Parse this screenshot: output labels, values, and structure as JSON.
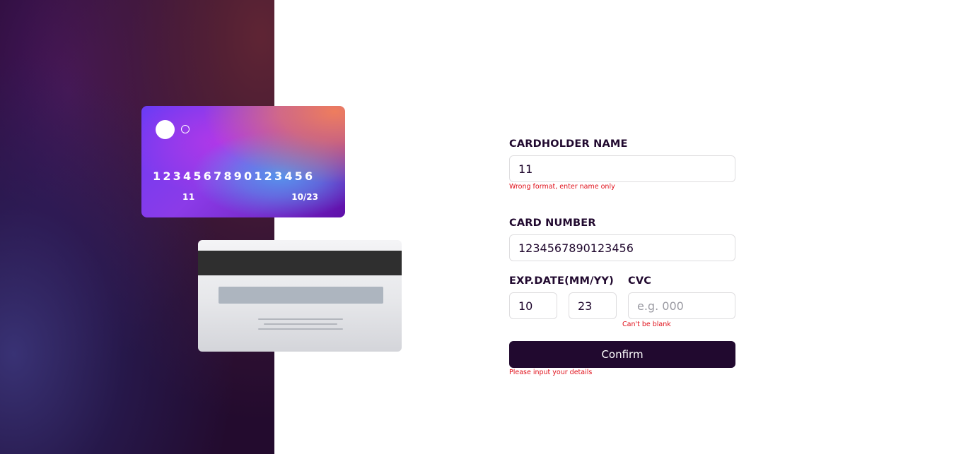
{
  "card_preview": {
    "front": {
      "number": "1234567890123456",
      "name": "11",
      "expiry": "10/23"
    }
  },
  "form": {
    "cardholder": {
      "label": "CARDHOLDER NAME",
      "value": "11",
      "error": "Wrong format, enter name only"
    },
    "card_number": {
      "label": "CARD NUMBER",
      "value": "1234567890123456"
    },
    "exp": {
      "label": "EXP.DATE(MM/YY)",
      "month_value": "10",
      "year_value": "23"
    },
    "cvc": {
      "label": "CVC",
      "placeholder": "e.g. 000",
      "value": "",
      "error": "Can't be blank"
    },
    "confirm": {
      "label": "Confirm",
      "error": "Please input your details"
    }
  },
  "colors": {
    "accent_dark": "#21092f",
    "error": "#e0101a",
    "input_border": "#dedddf"
  }
}
